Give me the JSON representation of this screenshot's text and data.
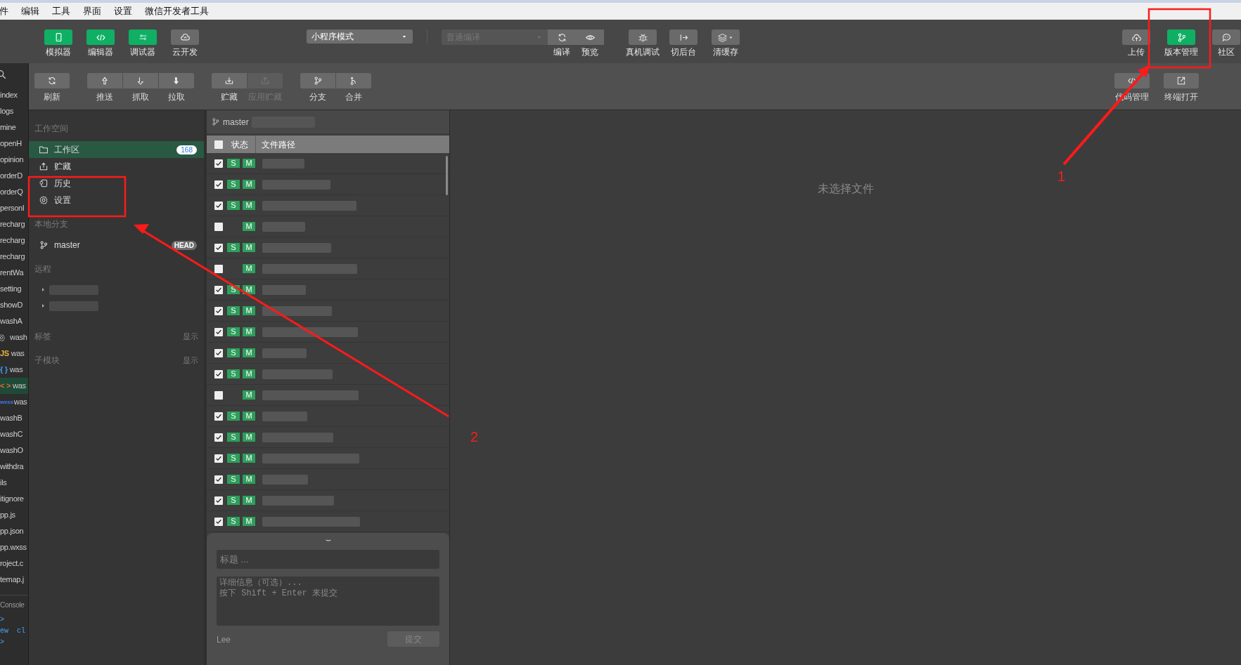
{
  "menu_bar": {
    "items": [
      "件",
      "编辑",
      "工具",
      "界面",
      "设置",
      "微信开发者工具"
    ]
  },
  "toolbar": {
    "left": [
      {
        "label": "模拟器",
        "active": true
      },
      {
        "label": "编辑器",
        "active": true
      },
      {
        "label": "调试器",
        "active": true
      },
      {
        "label": "云开发",
        "active": false
      }
    ],
    "mode_select": {
      "value": "小程序模式"
    },
    "compile_select": {
      "value": "普通编译",
      "disabled": true
    },
    "center": [
      {
        "label": "编译"
      },
      {
        "label": "预览"
      },
      {
        "label": "真机调试"
      },
      {
        "label": "切后台"
      },
      {
        "label": "清缓存"
      }
    ],
    "right": [
      {
        "label": "上传",
        "active": false
      },
      {
        "label": "版本管理",
        "active": true
      },
      {
        "label": "社区",
        "active": false
      }
    ]
  },
  "file_tree": {
    "items": [
      {
        "label": "index",
        "selected": false
      },
      {
        "label": "logs",
        "selected": false
      },
      {
        "label": "mine",
        "selected": false
      },
      {
        "label": "openH",
        "selected": false
      },
      {
        "label": "opinion",
        "selected": false
      },
      {
        "label": "orderD",
        "selected": false
      },
      {
        "label": "orderQ",
        "selected": false
      },
      {
        "label": "personI",
        "selected": false
      },
      {
        "label": "recharg",
        "selected": false
      },
      {
        "label": "recharg",
        "selected": false
      },
      {
        "label": "recharg",
        "selected": false
      },
      {
        "label": "rentWa",
        "selected": false
      },
      {
        "label": "setting",
        "selected": false
      },
      {
        "label": "showD",
        "selected": false
      },
      {
        "label": "washA",
        "selected": false
      },
      {
        "label": "wash",
        "selected": false,
        "kind": "folder"
      },
      {
        "label": "was",
        "selected": false,
        "tag": "JS",
        "color": "#e8b339"
      },
      {
        "label": "was",
        "selected": false,
        "tag": "{ }",
        "color": "#3d9be9"
      },
      {
        "label": "was",
        "selected": true,
        "tag": "< >",
        "color": "#e8692d"
      },
      {
        "label": "was",
        "selected": false,
        "tag": "wxss",
        "color": "#3d7be9"
      },
      {
        "label": "washB",
        "selected": false
      },
      {
        "label": "washC",
        "selected": false
      },
      {
        "label": "washO",
        "selected": false
      },
      {
        "label": "withdra",
        "selected": false
      },
      {
        "label": "ils",
        "selected": false
      },
      {
        "label": "itignore",
        "selected": false
      },
      {
        "label": "pp.js",
        "selected": false
      },
      {
        "label": "pp.json",
        "selected": false
      },
      {
        "label": "pp.wxss",
        "selected": false
      },
      {
        "label": "roject.c",
        "selected": false
      },
      {
        "label": "temap.j",
        "selected": false
      }
    ],
    "console": {
      "title": "Console",
      "lines": [
        ">",
        "ew  cl",
        ">"
      ]
    }
  },
  "vcs_toolbar": {
    "groups": [
      [
        {
          "label": "刷新",
          "disabled": false
        }
      ],
      [
        {
          "label": "推送",
          "disabled": false
        },
        {
          "label": "抓取",
          "disabled": false
        },
        {
          "label": "拉取",
          "disabled": false
        }
      ],
      [
        {
          "label": "贮藏",
          "disabled": false
        },
        {
          "label": "应用贮藏",
          "disabled": true
        }
      ],
      [
        {
          "label": "分支",
          "disabled": false
        },
        {
          "label": "合并",
          "disabled": false
        }
      ]
    ],
    "right": [
      {
        "label": "代码管理",
        "disabled": false
      },
      {
        "label": "终端打开",
        "disabled": false
      }
    ]
  },
  "sidebar": {
    "sections": [
      {
        "title": "工作空间",
        "items": [
          {
            "label": "工作区",
            "count": "168",
            "selected": true
          },
          {
            "label": "贮藏",
            "selected": false
          },
          {
            "label": "历史",
            "selected": false
          },
          {
            "label": "设置",
            "selected": false
          }
        ]
      },
      {
        "title": "本地分支",
        "items": [
          {
            "label": "master",
            "badge": "HEAD",
            "selected": false
          }
        ]
      },
      {
        "title": "远程",
        "remotes": [
          {
            "expanded": false
          },
          {
            "expanded": false
          }
        ]
      },
      {
        "title": "标签",
        "action": "显示"
      },
      {
        "title": "子模块",
        "action": "显示"
      }
    ]
  },
  "changes": {
    "branch": "master",
    "columns": [
      "状态",
      "文件路径"
    ],
    "all_checked": false,
    "rows": [
      {
        "checked": true,
        "staged": "S",
        "modified": "M"
      },
      {
        "checked": true,
        "staged": "S",
        "modified": "M"
      },
      {
        "checked": true,
        "staged": "S",
        "modified": "M"
      },
      {
        "checked": false,
        "modified": "M"
      },
      {
        "checked": true,
        "staged": "S",
        "modified": "M"
      },
      {
        "checked": false,
        "modified": "M"
      },
      {
        "checked": true,
        "staged": "S",
        "modified": "M"
      },
      {
        "checked": true,
        "staged": "S",
        "modified": "M"
      },
      {
        "checked": true,
        "staged": "S",
        "modified": "M"
      },
      {
        "checked": true,
        "staged": "S",
        "modified": "M"
      },
      {
        "checked": true,
        "staged": "S",
        "modified": "M"
      },
      {
        "checked": false,
        "modified": "M"
      },
      {
        "checked": true,
        "staged": "S",
        "modified": "M"
      },
      {
        "checked": true,
        "staged": "S",
        "modified": "M"
      },
      {
        "checked": true,
        "staged": "S",
        "modified": "M"
      },
      {
        "checked": true,
        "staged": "S",
        "modified": "M"
      },
      {
        "checked": true,
        "staged": "S",
        "modified": "M"
      },
      {
        "checked": true,
        "staged": "S",
        "modified": "M"
      }
    ]
  },
  "commit": {
    "title_placeholder": "标题 ...",
    "detail_placeholder": "详细信息（可选）...\n按下 Shift + Enter 来提交",
    "author": "Lee",
    "submit": {
      "label": "提交",
      "disabled": true
    }
  },
  "diff_view": {
    "empty_text": "未选择文件"
  },
  "annotations": [
    {
      "label": "1"
    },
    {
      "label": "2"
    }
  ]
}
